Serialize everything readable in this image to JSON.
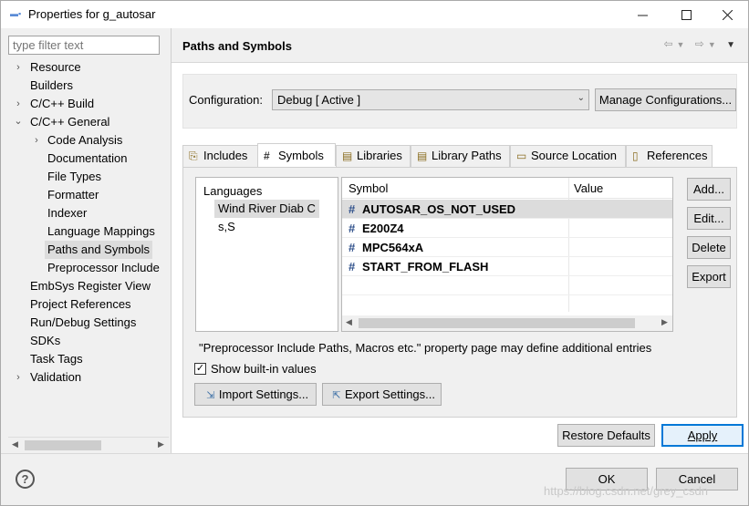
{
  "window": {
    "title": "Properties for g_autosar",
    "minimize_icon": "minimize-icon",
    "maximize_icon": "maximize-icon",
    "close_icon": "close-icon"
  },
  "filter": {
    "placeholder": "type filter text"
  },
  "tree": {
    "items": [
      {
        "label": "Resource",
        "chevron": "›"
      },
      {
        "label": "Builders",
        "chevron": ""
      },
      {
        "label": "C/C++ Build",
        "chevron": "›"
      },
      {
        "label": "C/C++ General",
        "chevron": "⌄"
      },
      {
        "label": "Code Analysis",
        "chevron": "›"
      },
      {
        "label": "Documentation",
        "chevron": ""
      },
      {
        "label": "File Types",
        "chevron": ""
      },
      {
        "label": "Formatter",
        "chevron": ""
      },
      {
        "label": "Indexer",
        "chevron": ""
      },
      {
        "label": "Language Mappings",
        "chevron": ""
      },
      {
        "label": "Paths and Symbols",
        "chevron": ""
      },
      {
        "label": "Preprocessor Include",
        "chevron": ""
      },
      {
        "label": "EmbSys Register View",
        "chevron": ""
      },
      {
        "label": "Project References",
        "chevron": ""
      },
      {
        "label": "Run/Debug Settings",
        "chevron": ""
      },
      {
        "label": "SDKs",
        "chevron": ""
      },
      {
        "label": "Task Tags",
        "chevron": ""
      },
      {
        "label": "Validation",
        "chevron": "›"
      }
    ]
  },
  "page": {
    "title": "Paths and Symbols"
  },
  "configuration": {
    "label": "Configuration:",
    "value": "Debug  [ Active ]",
    "manage_button": "Manage Configurations..."
  },
  "tabs": [
    {
      "label": "Includes",
      "icon": "includes-icon"
    },
    {
      "label": "Symbols",
      "icon": "hash-icon"
    },
    {
      "label": "Libraries",
      "icon": "libraries-icon"
    },
    {
      "label": "Library Paths",
      "icon": "library-paths-icon"
    },
    {
      "label": "Source Location",
      "icon": "source-location-icon"
    },
    {
      "label": "References",
      "icon": "references-icon"
    }
  ],
  "languages": {
    "header": "Languages",
    "items": [
      "Wind River Diab C",
      "s,S"
    ]
  },
  "symbols": {
    "col_symbol": "Symbol",
    "col_value": "Value",
    "rows": [
      {
        "name": "AUTOSAR_OS_NOT_USED",
        "value": ""
      },
      {
        "name": "E200Z4",
        "value": ""
      },
      {
        "name": "MPC564xA",
        "value": ""
      },
      {
        "name": "START_FROM_FLASH",
        "value": ""
      }
    ]
  },
  "side_buttons": {
    "add": "Add...",
    "edit": "Edit...",
    "delete": "Delete",
    "export": "Export"
  },
  "info_text": "\"Preprocessor Include Paths, Macros etc.\" property page may define additional entries",
  "show_builtin": {
    "label": "Show built-in values",
    "checked": true
  },
  "import_settings": "Import Settings...",
  "export_settings": "Export Settings...",
  "restore_defaults": "Restore Defaults",
  "apply": "Apply",
  "ok": "OK",
  "cancel": "Cancel",
  "watermark": "https://blog.csdn.net/grey_csdn"
}
